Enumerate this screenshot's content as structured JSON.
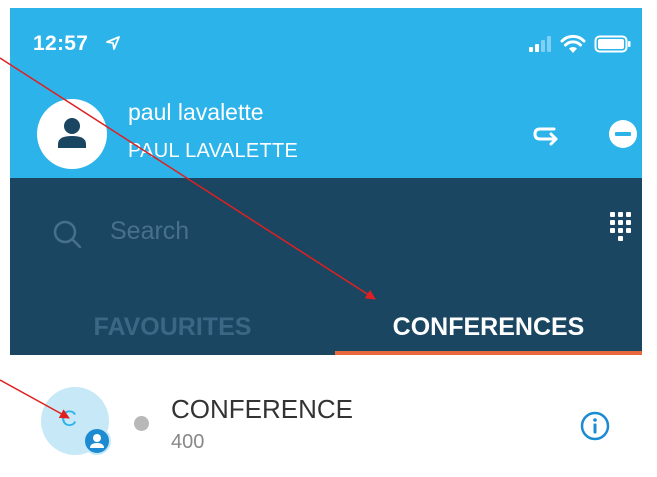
{
  "status_bar": {
    "time": "12:57",
    "location_icon": "location-arrow-icon",
    "signal_icon": "signal-icon",
    "wifi_icon": "wifi-icon",
    "battery_icon": "battery-icon"
  },
  "profile": {
    "name": "paul lavalette",
    "display_name": "PAUL LAVALETTE",
    "avatar_icon": "user-icon",
    "transfer_icon": "call-transfer-icon",
    "dnd_icon": "do-not-disturb-icon"
  },
  "search": {
    "placeholder": "Search",
    "icon": "search-icon",
    "dialpad_icon": "dialpad-icon"
  },
  "tabs": [
    {
      "label": "FAVOURITES",
      "active": false
    },
    {
      "label": "CONFERENCES",
      "active": true
    }
  ],
  "conferences": [
    {
      "avatar_letter": "C",
      "title": "CONFERENCE",
      "number": "400",
      "presence": "offline",
      "info_icon": "info-icon"
    }
  ],
  "colors": {
    "header": "#2cb3ea",
    "dark_panel": "#1a4662",
    "tab_active_underline": "#e9683d",
    "tab_inactive": "#3b6784",
    "annotation_arrow": "#e02020"
  }
}
